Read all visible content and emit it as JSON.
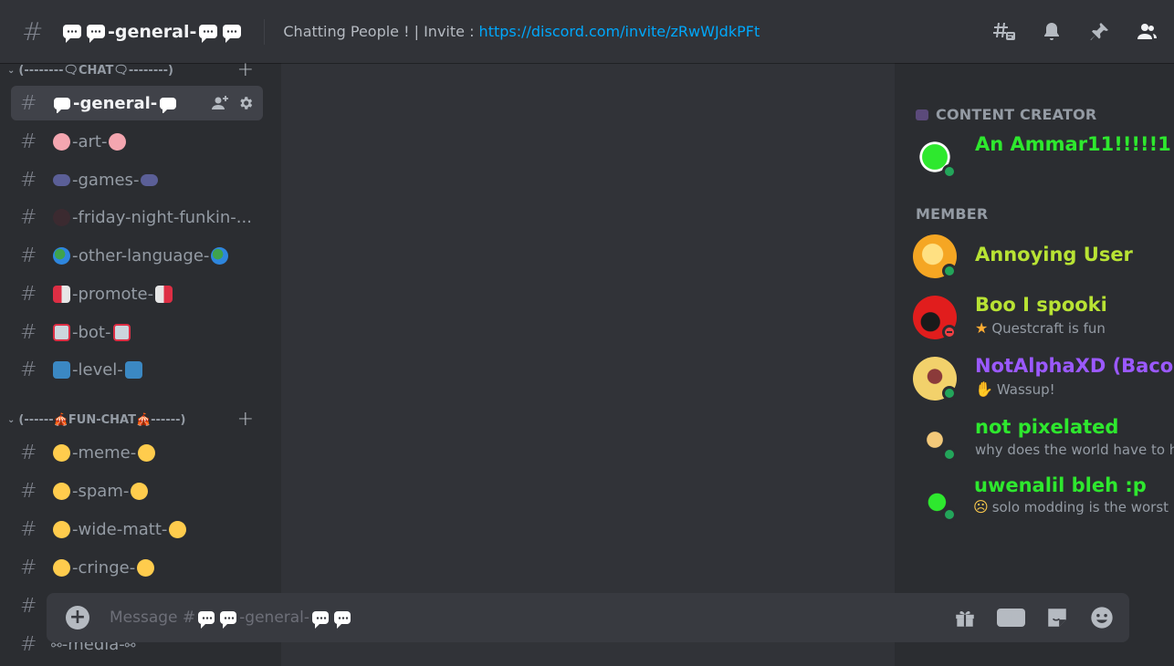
{
  "header": {
    "channel_name": "-general-",
    "topic_text": "Chatting People ! | Invite : ",
    "invite_link": "https://discord.com/invite/zRwWJdkPFt",
    "icons": [
      "threads-icon",
      "bell-icon",
      "pin-icon",
      "members-icon"
    ]
  },
  "sidebar": {
    "categories": [
      {
        "label": "(--------🗨CHAT🗨--------)"
      },
      {
        "label": "(------🎪FUN-CHAT🎪------)"
      }
    ],
    "channels": [
      {
        "label": "-general-"
      },
      {
        "label": "-art-"
      },
      {
        "label": "-games-"
      },
      {
        "label": "-friday-night-funkin-..."
      },
      {
        "label": "-other-language-"
      },
      {
        "label": "-promote-"
      },
      {
        "label": "-bot-"
      },
      {
        "label": "-level-"
      },
      {
        "label": "-meme-"
      },
      {
        "label": "-spam-"
      },
      {
        "label": "-wide-matt-"
      },
      {
        "label": "-cringe-"
      },
      {
        "label": ""
      },
      {
        "label": "-media-"
      }
    ]
  },
  "composer": {
    "placeholder_prefix": "Message #",
    "placeholder_channel": "-general-",
    "gif_label": "GIF"
  },
  "members": {
    "groups": [
      {
        "label": "CONTENT CREATOR"
      },
      {
        "label": "MEMBER"
      }
    ],
    "list": [
      {
        "name": "An Ammar11!!!!!1",
        "status_text": "",
        "color": "#2ee82e",
        "presence": "online"
      },
      {
        "name": "Annoying User",
        "status_text": "",
        "color": "#b8e334",
        "presence": "online"
      },
      {
        "name": "Boo I spooki",
        "status_text": "Questcraft is fun",
        "color": "#b8e334",
        "presence": "dnd"
      },
      {
        "name": "NotAlphaXD (BaconX",
        "status_text": "Wassup!",
        "color": "#9b59ff",
        "presence": "online"
      },
      {
        "name": "not pixelated",
        "status_text": "why does the world have to h",
        "color": "#2ee82e",
        "presence": "online"
      },
      {
        "name": "uwenalil bleh :p",
        "status_text": "solo modding is the worst",
        "color": "#2ee82e",
        "presence": "online"
      }
    ]
  },
  "colors": {
    "bg_main": "#313338",
    "bg_sidebar": "#2b2d31",
    "link": "#00a8fc",
    "online": "#23a55a",
    "dnd": "#f23f43"
  }
}
